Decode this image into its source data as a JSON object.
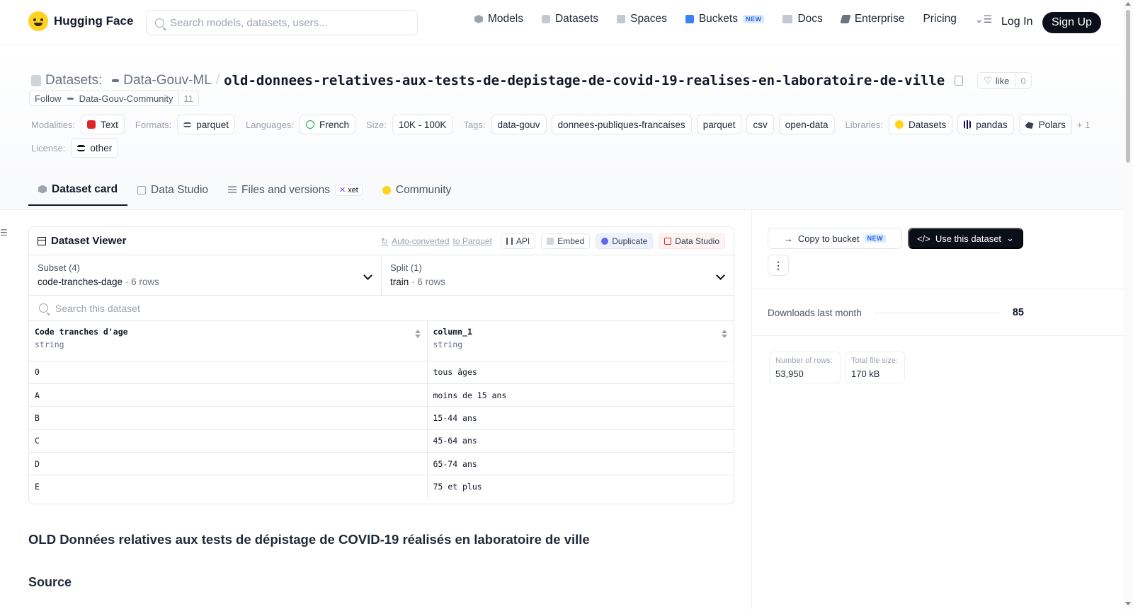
{
  "brand": {
    "name": "Hugging Face"
  },
  "search": {
    "placeholder": "Search models, datasets, users..."
  },
  "nav": {
    "items": [
      {
        "label": "Models",
        "icon": "cube-icon"
      },
      {
        "label": "Datasets",
        "icon": "database-icon"
      },
      {
        "label": "Spaces",
        "icon": "spaces-grid-icon"
      },
      {
        "label": "Buckets",
        "icon": "bucket-icon",
        "badge": "NEW"
      },
      {
        "label": "Docs",
        "icon": "book-icon"
      },
      {
        "label": "Enterprise",
        "icon": "enterprise-icon"
      },
      {
        "label": "Pricing"
      }
    ],
    "login": "Log In",
    "signup": "Sign Up"
  },
  "repo": {
    "type_label": "Datasets:",
    "org": "Data-Gouv-ML",
    "separator": "/",
    "name": "old-donnees-relatives-aux-tests-de-depistage-de-covid-19-realises-en-laboratoire-de-ville",
    "like_label": "like",
    "like_count": "0",
    "follow_label": "Follow",
    "follow_org": "Data-Gouv-Community",
    "follow_count": "11"
  },
  "tags": {
    "modalities_label": "Modalities:",
    "modalities": [
      "Text"
    ],
    "formats_label": "Formats:",
    "formats": [
      "parquet"
    ],
    "languages_label": "Languages:",
    "languages": [
      "French"
    ],
    "size_label": "Size:",
    "size": [
      "10K - 100K"
    ],
    "tags_label": "Tags:",
    "tags": [
      "data-gouv",
      "donnees-publiques-francaises",
      "parquet",
      "csv",
      "open-data"
    ],
    "libraries_label": "Libraries:",
    "libraries": [
      "Datasets",
      "pandas",
      "Polars"
    ],
    "libraries_more": "+ 1",
    "license_label": "License:",
    "license": [
      "other"
    ]
  },
  "tabs": [
    {
      "label": "Dataset card",
      "active": true
    },
    {
      "label": "Data Studio"
    },
    {
      "label": "Files and versions",
      "badge": "xet"
    },
    {
      "label": "Community"
    }
  ],
  "viewer": {
    "title": "Dataset Viewer",
    "auto_converted_pre": "Auto-converted",
    "auto_converted_post": "to Parquet",
    "actions": [
      "API",
      "Embed",
      "Duplicate",
      "Data Studio"
    ],
    "subset_label": "Subset (4)",
    "subset_value": "code-tranches-dage",
    "subset_rows": "6 rows",
    "split_label": "Split (1)",
    "split_value": "train",
    "split_rows": "6 rows",
    "search_placeholder": "Search this dataset",
    "columns": [
      {
        "name": "Code tranches d'age",
        "type": "string"
      },
      {
        "name": "column_1",
        "type": "string"
      }
    ],
    "rows": [
      [
        "0",
        "tous âges"
      ],
      [
        "A",
        "moins de 15 ans"
      ],
      [
        "B",
        "15-44 ans"
      ],
      [
        "C",
        "45-64 ans"
      ],
      [
        "D",
        "65-74 ans"
      ],
      [
        "E",
        "75 et plus"
      ]
    ]
  },
  "card": {
    "heading": "OLD Données relatives aux tests de dépistage de COVID-19 réalisés en laboratoire de ville",
    "section_source": "Source"
  },
  "side": {
    "copy_to_bucket": "Copy to bucket",
    "copy_badge": "NEW",
    "use_dataset": "Use this dataset",
    "kebab": "⋮",
    "downloads_label": "Downloads last month",
    "downloads_value": "85",
    "rows_label": "Number of rows:",
    "rows_value": "53,950",
    "size_label": "Total file size:",
    "size_value": "170 kB"
  },
  "colors": {
    "accent_dark": "#0b0f1a",
    "brand_yellow": "#FFD21E",
    "new_badge": "#2563eb"
  }
}
